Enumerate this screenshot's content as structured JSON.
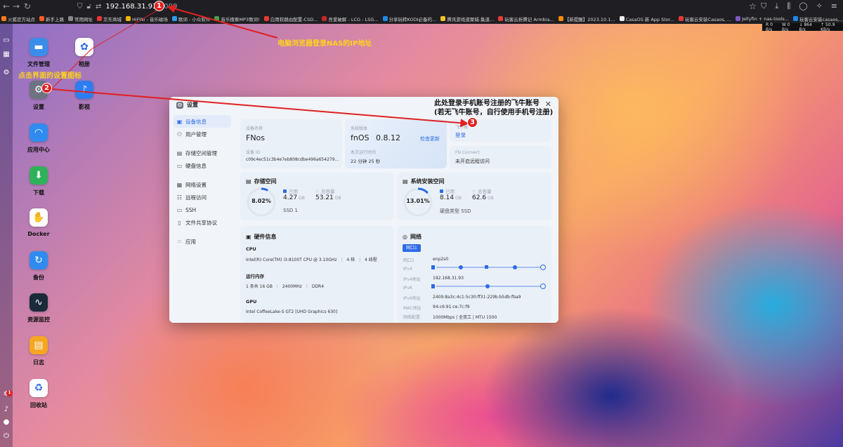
{
  "browser": {
    "url_host": "192.168.31.93",
    "url_port": ":8000",
    "bookmarks": [
      {
        "label": "火狐官方站点",
        "color": "#ff7a1a"
      },
      {
        "label": "新手上路",
        "color": "#ff5a2a"
      },
      {
        "label": "常用网址",
        "color": "#888888"
      },
      {
        "label": "京东商城",
        "color": "#e53935"
      },
      {
        "label": "HiFiNi - 音乐磁场",
        "color": "#f5b400"
      },
      {
        "label": "歌词 - 小众软件",
        "color": "#2a9df4"
      },
      {
        "label": "音乐搜索MP3歌词!",
        "color": "#43a047"
      },
      {
        "label": "白用软路由配置-CSD...",
        "color": "#e53935"
      },
      {
        "label": "吾爱破解 - LCG - LSG...",
        "color": "#c62828"
      },
      {
        "label": "分享玩转KODI必备的...",
        "color": "#1e88e5"
      },
      {
        "label": "腾讯游戏道聚城-集道...",
        "color": "#fbc02d"
      },
      {
        "label": "玩客云折腾记 Armbia...",
        "color": "#e53935"
      },
      {
        "label": "【新提醒】2023.10.1...",
        "color": "#fb8c00"
      },
      {
        "label": "CasaOS 新 App Stor...",
        "color": "#eeeeee"
      },
      {
        "label": "玩客云安装Casaos, ...",
        "color": "#e53935"
      },
      {
        "label": "Jellyfin + nas-tools...",
        "color": "#7e57c2"
      },
      {
        "label": "玩客云安装casaos,...",
        "color": "#1e88e5"
      }
    ],
    "net_monitor": [
      "R 0 B/s",
      "W 0 B/s",
      "↓ 864 B/s",
      "↑ 50.9 KB/s"
    ]
  },
  "desktop": {
    "icons": [
      {
        "label": "文件管理",
        "icon": "folder-icon",
        "glyph": "▬",
        "color": "#3b8dea"
      },
      {
        "label": "相册",
        "icon": "photos-icon",
        "glyph": "✿",
        "color": "#ffffff"
      },
      {
        "label": "设置",
        "icon": "gear-icon",
        "glyph": "⚙",
        "color": "#6d7380"
      },
      {
        "label": "影视",
        "icon": "film-icon",
        "glyph": "♪",
        "color": "#2e7df0"
      },
      {
        "label": "应用中心",
        "icon": "store-icon",
        "glyph": "◠",
        "color": "#2f8bf0"
      },
      {
        "label": "下载",
        "icon": "download-icon",
        "glyph": "⬇",
        "color": "#2fb15a"
      },
      {
        "label": "Docker",
        "icon": "docker-icon",
        "glyph": "✋",
        "color": "#ffffff"
      },
      {
        "label": "备份",
        "icon": "backup-icon",
        "glyph": "↻",
        "color": "#2f8bf0"
      },
      {
        "label": "资源监控",
        "icon": "monitor-icon",
        "glyph": "∿",
        "color": "#1b2a3a"
      },
      {
        "label": "日志",
        "icon": "log-icon",
        "glyph": "▤",
        "color": "#f5a623"
      },
      {
        "label": "回收站",
        "icon": "trash-icon",
        "glyph": "♻",
        "color": "#ffffff"
      }
    ]
  },
  "annotations": {
    "step1_text": "电脑浏览器登录NAS的IP地址",
    "step2_text": "点击界面的设置图标",
    "step3_line1": "此处登录手机账号注册的飞牛账号",
    "step3_line2": "(若无飞牛账号，自行使用手机号注册)",
    "badge1": "1",
    "badge2": "2",
    "badge3": "3",
    "rail_badge": "1",
    "colors": {
      "red": "#e02020",
      "yellow": "#ffd21a"
    }
  },
  "settings": {
    "title": "设置",
    "menu": [
      [
        {
          "label": "设备信息",
          "icon": "info-icon",
          "glyph": "▣",
          "active": true
        },
        {
          "label": "用户管理",
          "icon": "user-icon",
          "glyph": "⚇",
          "active": false
        }
      ],
      [
        {
          "label": "存储空间管理",
          "icon": "storage-icon",
          "glyph": "▤",
          "active": false
        },
        {
          "label": "硬盘信息",
          "icon": "disk-icon",
          "glyph": "▭",
          "active": false
        }
      ],
      [
        {
          "label": "网络设置",
          "icon": "network-icon",
          "glyph": "▦",
          "active": false
        },
        {
          "label": "远程访问",
          "icon": "remote-icon",
          "glyph": "☷",
          "active": false
        },
        {
          "label": "SSH",
          "icon": "ssh-icon",
          "glyph": "▭",
          "active": false
        },
        {
          "label": "文件共享协议",
          "icon": "share-icon",
          "glyph": "▯",
          "active": false
        }
      ],
      [
        {
          "label": "应用",
          "icon": "apps-icon",
          "glyph": "⁙",
          "active": false
        }
      ]
    ],
    "device": {
      "name_label": "设备名称",
      "name": "FNos",
      "id_label": "设备 ID",
      "id": "c09c4ec51c3b4e7eb808cdbe496a654279..."
    },
    "system": {
      "label": "系统版本",
      "name": "fnOS",
      "version": "0.8.12",
      "check_update": "检查更新",
      "uptime_label": "本次运行时间",
      "uptime": "22 分钟 25 秒"
    },
    "account": {
      "label": "飞牛账",
      "login": "登录"
    },
    "fn_connect": {
      "label": "FN Connect",
      "value": "未开启远程访问"
    },
    "storage": {
      "title": "存储空间",
      "percent_text": "8.02%",
      "percent": 8.02,
      "used_label": "已用",
      "used": "4.27",
      "total_label": "总容量",
      "total": "53.21",
      "unit": "GB",
      "extra_label": "SSD",
      "extra_value": "1"
    },
    "sys_storage": {
      "title": "系统安装空间",
      "percent_text": "13.01%",
      "percent": 13.01,
      "used_label": "已用",
      "used": "8.14",
      "total_label": "总容量",
      "total": "62.6",
      "unit": "GB",
      "extra_label": "硬盘类型",
      "extra_value": "SSD"
    },
    "hardware": {
      "title": "硬件信息",
      "cpu_label": "CPU",
      "cpu": "Intel(R) Core(TM) i3-8100T CPU @ 3.10GHz",
      "cores": "4 核",
      "threads": "4 线程",
      "mem_label": "运行内存",
      "mem": "1 条共 16 GB",
      "mem_speed": "2400MHz",
      "mem_type": "DDR4",
      "gpu_label": "GPU",
      "gpu": "Intel CoffeeLake-S GT2 [UHD Graphics 630]"
    },
    "network": {
      "title": "网络",
      "tab": "网口1",
      "rows": [
        {
          "k": "网口1",
          "v": "enp2s0"
        },
        {
          "k": "IPv4",
          "v": ""
        },
        {
          "k": "IPv4地址",
          "v": "192.168.31.93"
        },
        {
          "k": "IPv6",
          "v": ""
        },
        {
          "k": "IPv6地址",
          "v": "2409:8a3c:4c1:5c30:ff31:229b:b5db:fba9"
        },
        {
          "k": "MAC地址",
          "v": "94:c6:91:ce:7c:f9"
        },
        {
          "k": "网络配置",
          "v": "1000Mbps   |   全双工   |   MTU 1500"
        }
      ]
    }
  }
}
